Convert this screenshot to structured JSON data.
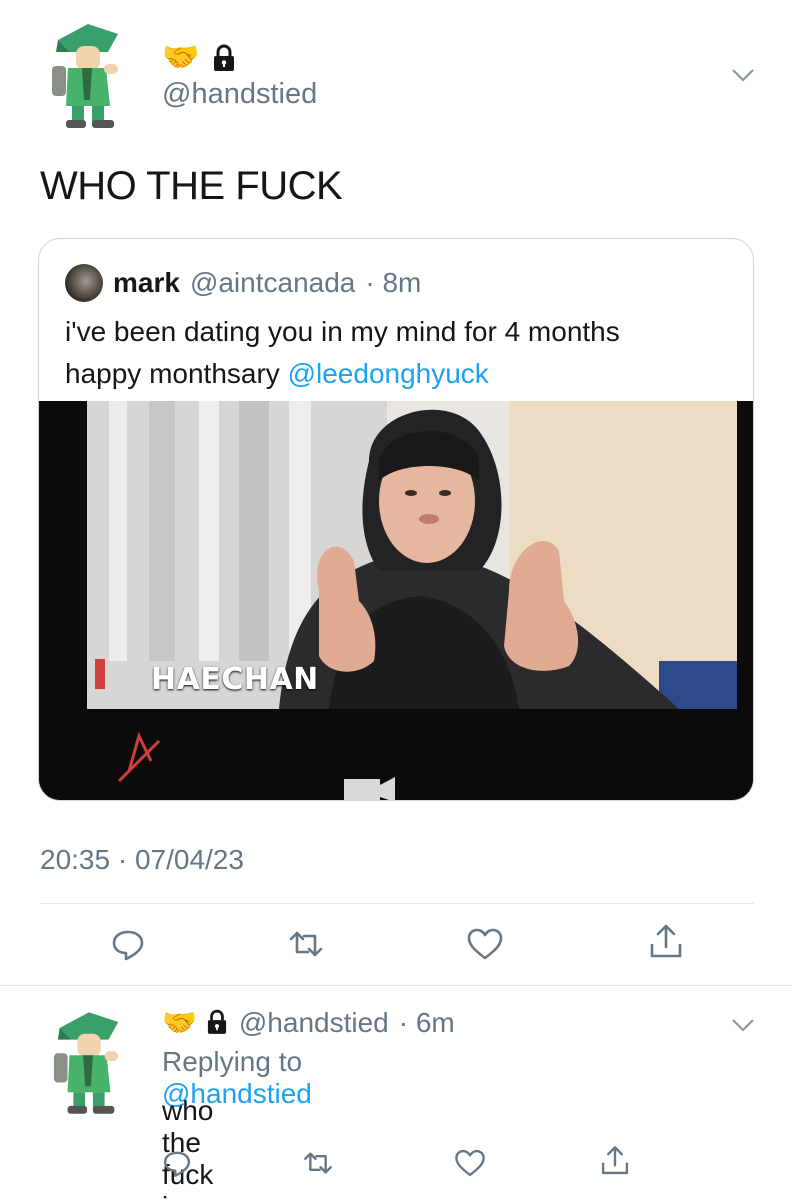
{
  "main_tweet": {
    "emoji": "🤝",
    "handle": "@handstied",
    "text": "WHO THE FUCK",
    "timestamp": "20:35 · 07/04/23",
    "quote": {
      "name": "mark",
      "handle": "@aintcanada",
      "time": "· 8m",
      "text_line1": "i've been dating you in my mind for 4 months",
      "text_line2_prefix": "happy monthsary ",
      "mention": "@leedonghyuck",
      "image_label": "HAECHAN"
    },
    "actions": [
      "reply-icon",
      "retweet-icon",
      "like-icon",
      "share-icon"
    ]
  },
  "reply_tweet": {
    "emoji": "🤝",
    "handle": "@handstied",
    "time": "· 6m",
    "replying_prefix": "Replying to ",
    "replying_handle": "@handstied",
    "text": "who the fuck is mark",
    "actions": [
      "reply-icon",
      "retweet-icon",
      "like-icon",
      "share-icon"
    ]
  },
  "colors": {
    "accent": "#1da1f2",
    "secondary_text": "#657786",
    "border": "#ccd6dd"
  }
}
